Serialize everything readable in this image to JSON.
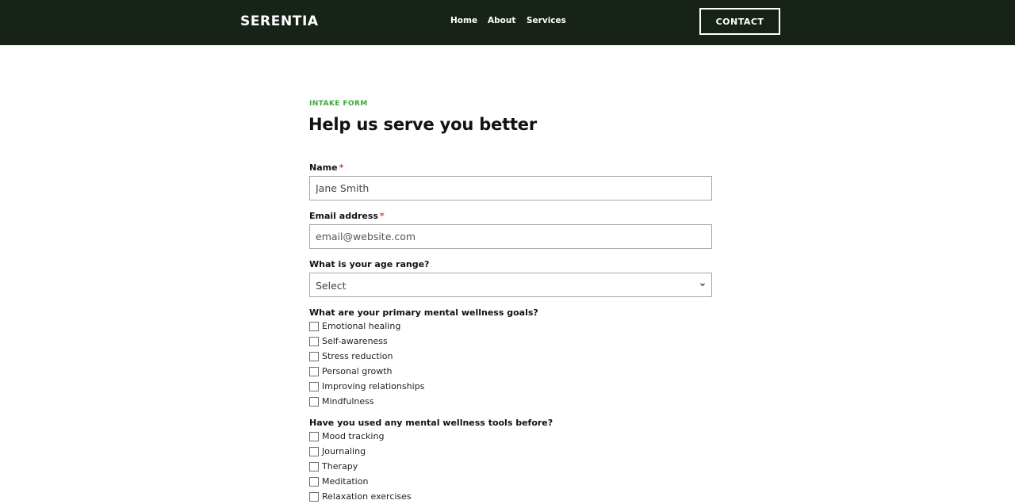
{
  "header": {
    "logo": "SERENTIA",
    "nav": [
      "Home",
      "About",
      "Services"
    ],
    "contact_label": "CONTACT",
    "background": "#182318"
  },
  "form": {
    "eyebrow": "INTAKE FORM",
    "title": "Help us serve you better",
    "accent_color": "#3aa83a",
    "required_marker": "*",
    "name": {
      "label": "Name",
      "value": "Jane Smith",
      "required": true
    },
    "email": {
      "label": "Email address",
      "placeholder": "email@website.com",
      "required": true
    },
    "age": {
      "label": "What is your age range?",
      "selected": "Select"
    },
    "goals": {
      "label": "What are your primary mental wellness goals?",
      "options": [
        "Emotional healing",
        "Self-awareness",
        "Stress reduction",
        "Personal growth",
        "Improving relationships",
        "Mindfulness"
      ]
    },
    "tools": {
      "label": "Have you used any mental wellness tools before?",
      "options": [
        "Mood tracking",
        "Journaling",
        "Therapy",
        "Meditation",
        "Relaxation exercises"
      ]
    }
  }
}
